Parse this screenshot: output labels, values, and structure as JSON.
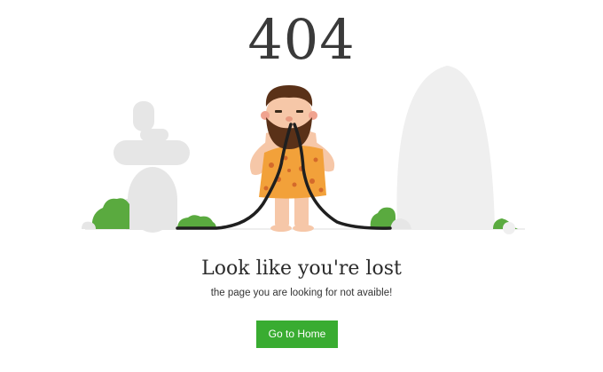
{
  "error": {
    "code": "404",
    "headline": "Look like you're lost",
    "message": "the page you are looking for not avaible!"
  },
  "actions": {
    "home_label": "Go to Home"
  },
  "colors": {
    "button_bg": "#39ac31",
    "button_text": "#ffffff",
    "heading": "#3a3a3a",
    "bush": "#5aaa3f",
    "rock": "#e6e6e6"
  },
  "illustration": {
    "icons": [
      "caveman-illustration",
      "rock-cairn-icon",
      "boulder-icon",
      "bush-icon",
      "cable-icon"
    ]
  }
}
